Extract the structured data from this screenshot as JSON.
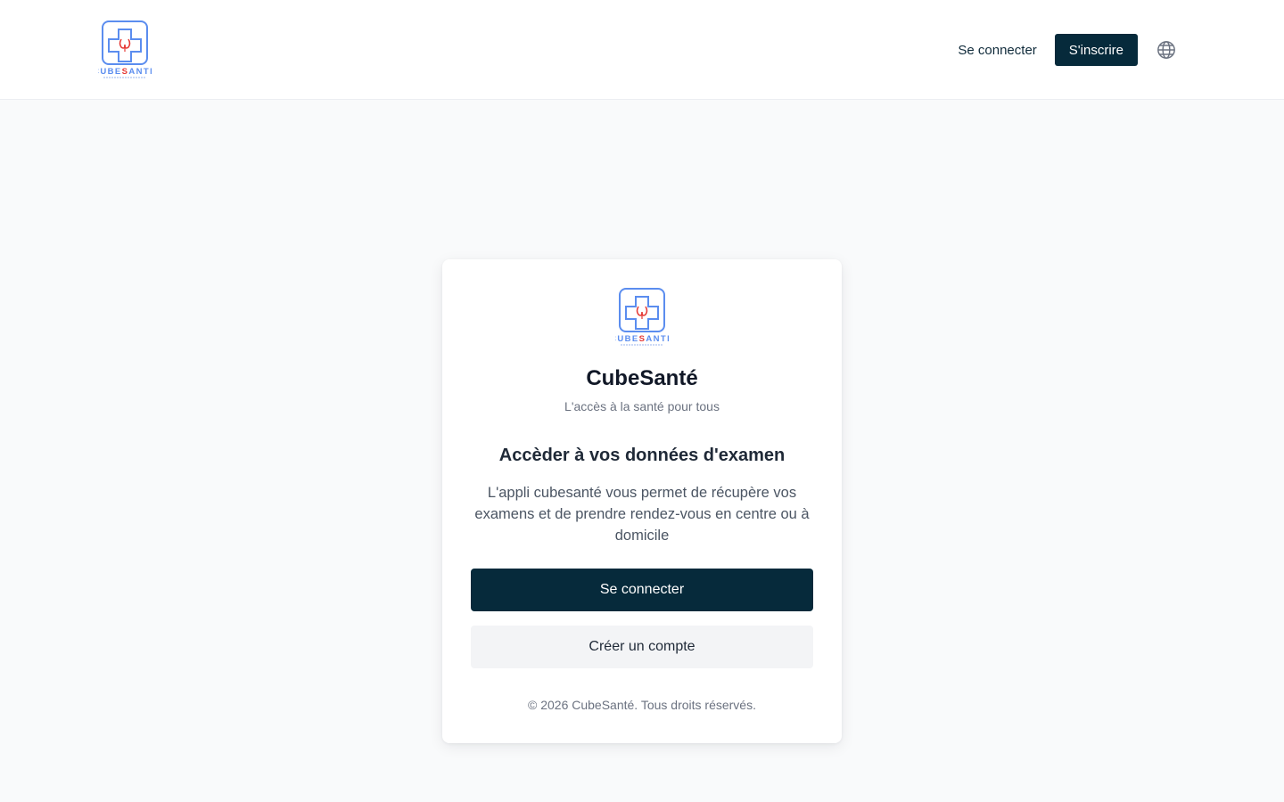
{
  "header": {
    "logo": {
      "wordmark_part1": "CUBE",
      "wordmark_mid": "S",
      "wordmark_part2": "ANTÉ",
      "icon": "medical-cross-logo-icon"
    },
    "nav": {
      "login_label": "Se connecter",
      "signup_label": "S'inscrire",
      "language_icon": "globe-icon"
    }
  },
  "card": {
    "logo": {
      "wordmark_part1": "CUBE",
      "wordmark_mid": "S",
      "wordmark_part2": "ANTÉ",
      "icon": "medical-cross-logo-icon"
    },
    "brand_title": "CubeSanté",
    "brand_tagline": "L'accès à la santé pour tous",
    "headline": "Accèder à vos données d'examen",
    "description": "L'appli cubesanté vous permet de récupère vos examens et de prendre rendez-vous en centre ou à domicile",
    "primary_button": "Se connecter",
    "secondary_button": "Créer un compte",
    "footer": "© 2026 CubeSanté. Tous droits réservés."
  },
  "colors": {
    "brand_dark": "#062a3b",
    "logo_blue": "#5b8def",
    "logo_red": "#e53935",
    "background": "#f9fafb"
  }
}
